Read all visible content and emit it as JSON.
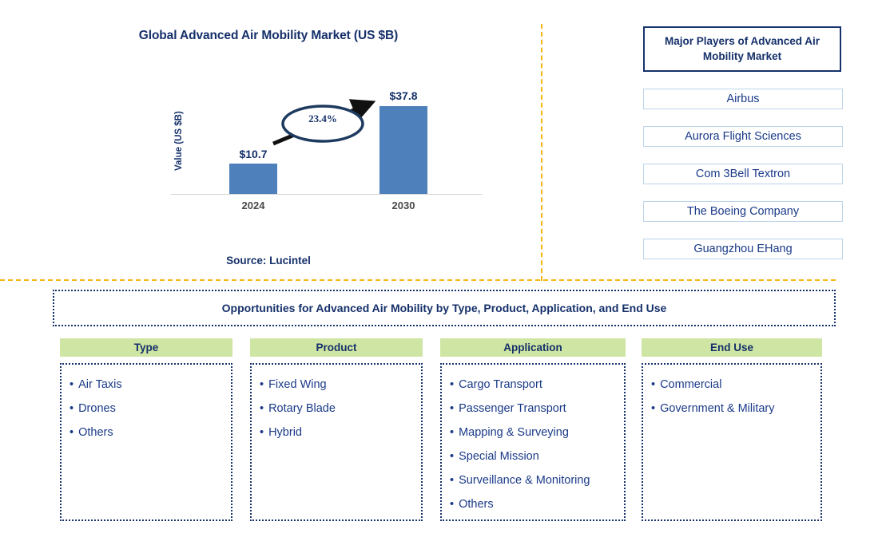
{
  "chart_panel": {
    "title": "Global Advanced Air Mobility Market (US $B)",
    "ylabel": "Value (US $B)",
    "cagr_label": "23.4%",
    "source": "Source: Lucintel"
  },
  "chart_data": {
    "type": "bar",
    "title": "Global Advanced Air Mobility Market (US $B)",
    "categories": [
      "2024",
      "2030"
    ],
    "values": [
      10.7,
      37.8
    ],
    "value_labels": [
      "$10.7",
      "$37.8"
    ],
    "xlabel": "",
    "ylabel": "Value (US $B)",
    "ylim": [
      0,
      44
    ],
    "grid": false,
    "legend": false,
    "bar_color": "#4e80bc",
    "annotations": [
      {
        "text": "23.4%",
        "kind": "cagr-callout",
        "from": "2024",
        "to": "2030"
      }
    ],
    "source": "Source: Lucintel"
  },
  "players": {
    "title": "Major Players of Advanced Air Mobility Market",
    "items": [
      "Airbus",
      "Aurora Flight Sciences",
      "Com 3Bell Textron",
      "The Boeing Company",
      "Guangzhou EHang"
    ]
  },
  "opportunities": {
    "title": "Opportunities for Advanced Air Mobility by Type, Product, Application, and End Use",
    "columns": [
      {
        "header": "Type",
        "items": [
          "Air Taxis",
          "Drones",
          "Others"
        ]
      },
      {
        "header": "Product",
        "items": [
          "Fixed Wing",
          "Rotary Blade",
          "Hybrid"
        ]
      },
      {
        "header": "Application",
        "items": [
          "Cargo Transport",
          "Passenger Transport",
          "Mapping & Surveying",
          "Special Mission",
          "Surveillance & Monitoring",
          "Others"
        ]
      },
      {
        "header": "End Use",
        "items": [
          "Commercial",
          "Government & Military"
        ]
      }
    ]
  },
  "colors": {
    "navy": "#15306a",
    "bar_blue": "#4e80bc",
    "header_green": "#cfe5a3",
    "divider_amber": "#f5b611",
    "link_blue": "#1a3a88"
  }
}
